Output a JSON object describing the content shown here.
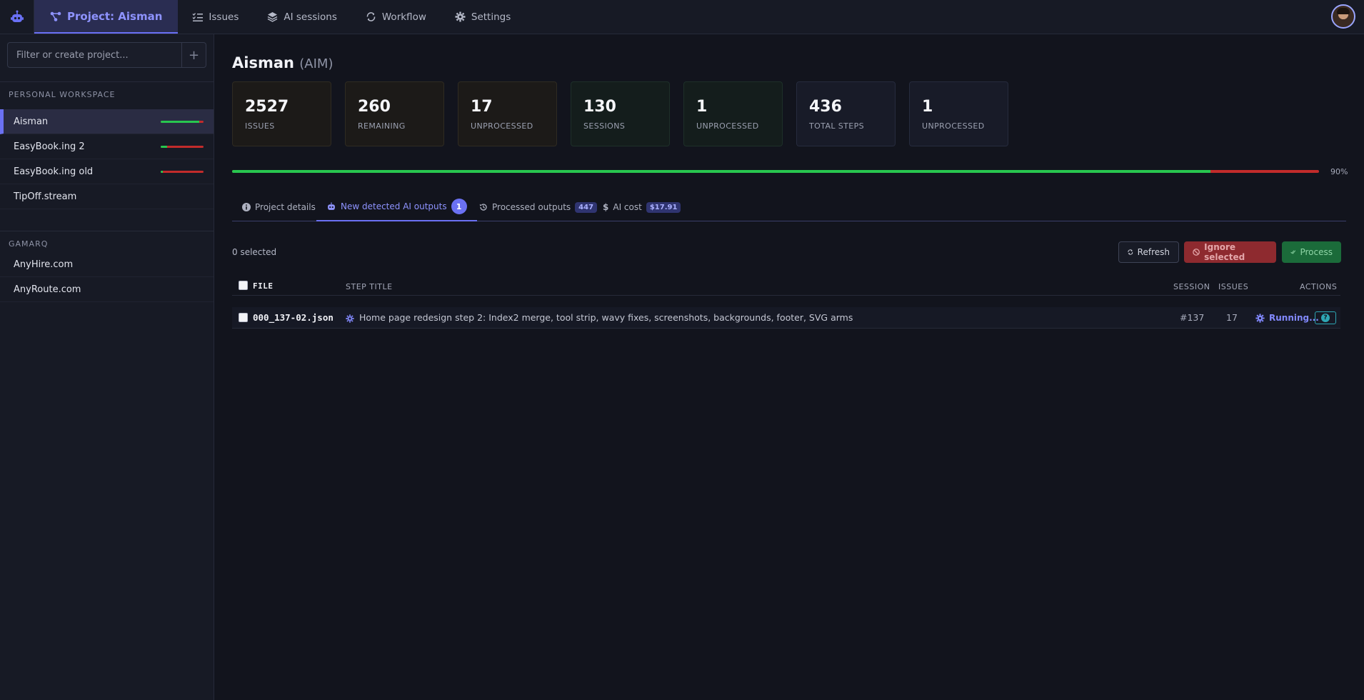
{
  "nav": {
    "project_label": "Project: Aisman",
    "items": [
      "Issues",
      "AI sessions",
      "Workflow",
      "Settings"
    ]
  },
  "sidebar": {
    "filter_placeholder": "Filter or create project...",
    "add_symbol": "+",
    "personal_label": "PERSONAL WORKSPACE",
    "personal_projects": [
      {
        "name": "Aisman",
        "progress": 0.9
      },
      {
        "name": "EasyBook.ing 2",
        "progress": 0.15
      },
      {
        "name": "EasyBook.ing old",
        "progress": 0.05
      },
      {
        "name": "TipOff.stream"
      }
    ],
    "gamarq_label": "GAMARQ",
    "gamarq_projects": [
      {
        "name": "AnyHire.com"
      },
      {
        "name": "AnyRoute.com"
      }
    ]
  },
  "project": {
    "name": "Aisman",
    "code": "(AIM)",
    "stats": [
      {
        "value": "2527",
        "label": "ISSUES"
      },
      {
        "value": "260",
        "label": "REMAINING"
      },
      {
        "value": "17",
        "label": "UNPROCESSED"
      },
      {
        "value": "130",
        "label": "SESSIONS"
      },
      {
        "value": "1",
        "label": "UNPROCESSED"
      },
      {
        "value": "436",
        "label": "TOTAL STEPS"
      },
      {
        "value": "1",
        "label": "UNPROCESSED"
      }
    ],
    "progress": 0.9,
    "progress_text": "90%"
  },
  "tabs": {
    "details": "Project details",
    "new_outputs": "New detected AI outputs",
    "new_outputs_count": "1",
    "processed": "Processed outputs",
    "processed_count": "447",
    "cost": "AI cost",
    "cost_value": "$17.91"
  },
  "toolbar": {
    "selected": "0 selected",
    "refresh": "Refresh",
    "ignore": "Ignore selected",
    "process": "Process"
  },
  "table": {
    "headers": {
      "file": "FILE",
      "step": "STEP TITLE",
      "session": "SESSION",
      "issues": "ISSUES",
      "actions": "ACTIONS"
    },
    "rows": [
      {
        "file": "000_137-02.json",
        "step": "Home page redesign step 2: Index2 merge, tool strip, wavy fixes, screenshots, backgrounds, footer, SVG arms",
        "session": "#137",
        "issues": "17",
        "status": "Running..."
      }
    ]
  },
  "colors": {
    "accent": "#6b71f3",
    "success": "#28c64f",
    "danger": "#c22b2b",
    "background": "#12141d"
  }
}
